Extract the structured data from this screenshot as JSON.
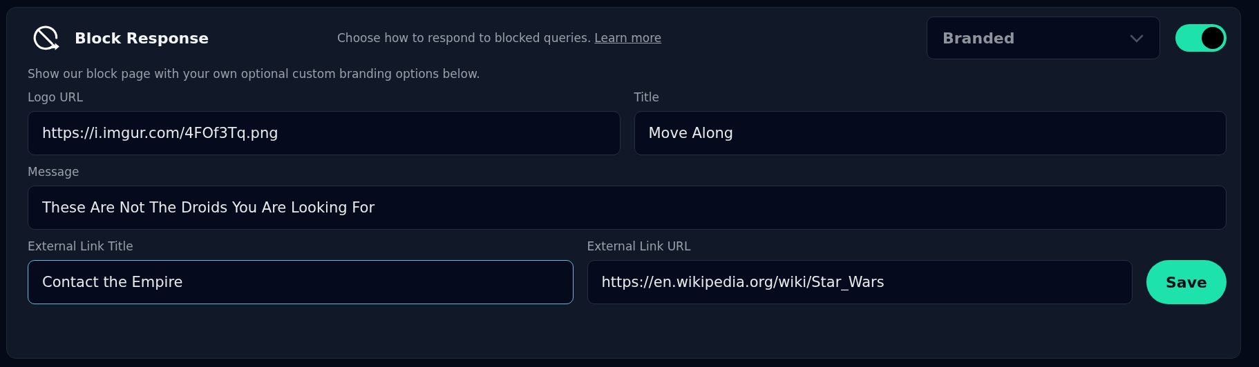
{
  "header": {
    "title": "Block Response",
    "description": "Choose how to respond to blocked queries.",
    "link": "Learn more",
    "mode": {
      "value": "Branded"
    },
    "enabled": {
      "on": true
    }
  },
  "subtitle": "Show our block page with your own optional custom branding options below.",
  "rows": [
    {
      "fields": [
        {
          "label": "Logo URL",
          "value": "https://i.imgur.com/4FOf3Tq.png",
          "focused": false
        },
        {
          "label": "Title",
          "value": "Move Along",
          "focused": false
        }
      ]
    },
    {
      "fields": [
        {
          "label": "Message",
          "value": "These Are Not The Droids You Are Looking For",
          "focused": false
        }
      ]
    },
    {
      "fields": [
        {
          "label": "External Link Title",
          "value": "Contact the Empire",
          "focused": true
        },
        {
          "label": "External Link URL",
          "value": "https://en.wikipedia.org/wiki/Star_Wars",
          "focused": false
        }
      ],
      "button": "Save"
    }
  ]
}
